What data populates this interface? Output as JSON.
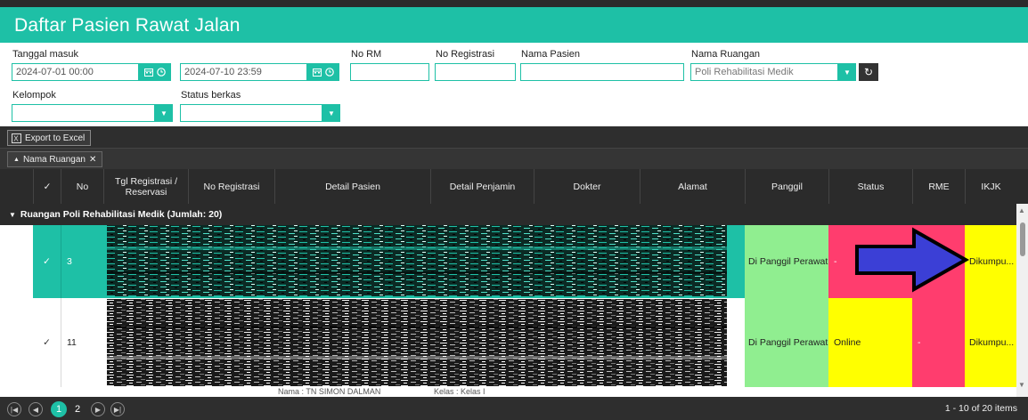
{
  "title": "Daftar Pasien Rawat Jalan",
  "filters": {
    "tanggal_masuk_label": "Tanggal masuk",
    "date_from": "2024-07-01 00:00",
    "date_to": "2024-07-10 23:59",
    "no_rm_label": "No RM",
    "no_registrasi_label": "No Registrasi",
    "nama_pasien_label": "Nama Pasien",
    "nama_ruangan_label": "Nama Ruangan",
    "nama_ruangan_value": "Poli Rehabilitasi Medik",
    "kelompok_label": "Kelompok",
    "status_berkas_label": "Status berkas"
  },
  "toolbar": {
    "export_label": "Export to Excel"
  },
  "grouping": {
    "chip_label": "Nama Ruangan"
  },
  "columns": {
    "check": "✓",
    "no": "No",
    "tgl": "Tgl Registrasi / Reservasi",
    "noreg": "No Registrasi",
    "detail_pasien": "Detail Pasien",
    "detail_penjamin": "Detail Penjamin",
    "dokter": "Dokter",
    "alamat": "Alamat",
    "panggil": "Panggil",
    "status": "Status",
    "rme": "RME",
    "ikjk": "IKJK"
  },
  "group_header": "Ruangan Poli Rehabilitasi Medik (Jumlah: 20)",
  "rows": [
    {
      "check": "✓",
      "no": "3",
      "panggil": "Di Panggil Perawat",
      "status": "-",
      "rme": "",
      "ikjk": "Dikumpu..."
    },
    {
      "check": "✓",
      "no": "11",
      "panggil": "Di Panggil Perawat",
      "status": "Online",
      "rme": "-",
      "ikjk": "Dikumpu..."
    }
  ],
  "partial_row": {
    "pasien_snippet": "Nama : TN SIMON DALMAN",
    "penjamin_snippet": "Kelas : Kelas I"
  },
  "pager": {
    "page1": "1",
    "page2": "2",
    "info": "1 - 10 of 20 items"
  },
  "colors": {
    "accent": "#1ec0a6",
    "panggil_bg": "#90ee90",
    "status_red": "#ff3d6e",
    "status_yellow": "#ffff00",
    "arrow_fill": "#3b3fd6",
    "selected_row": "#1ec0a6"
  }
}
